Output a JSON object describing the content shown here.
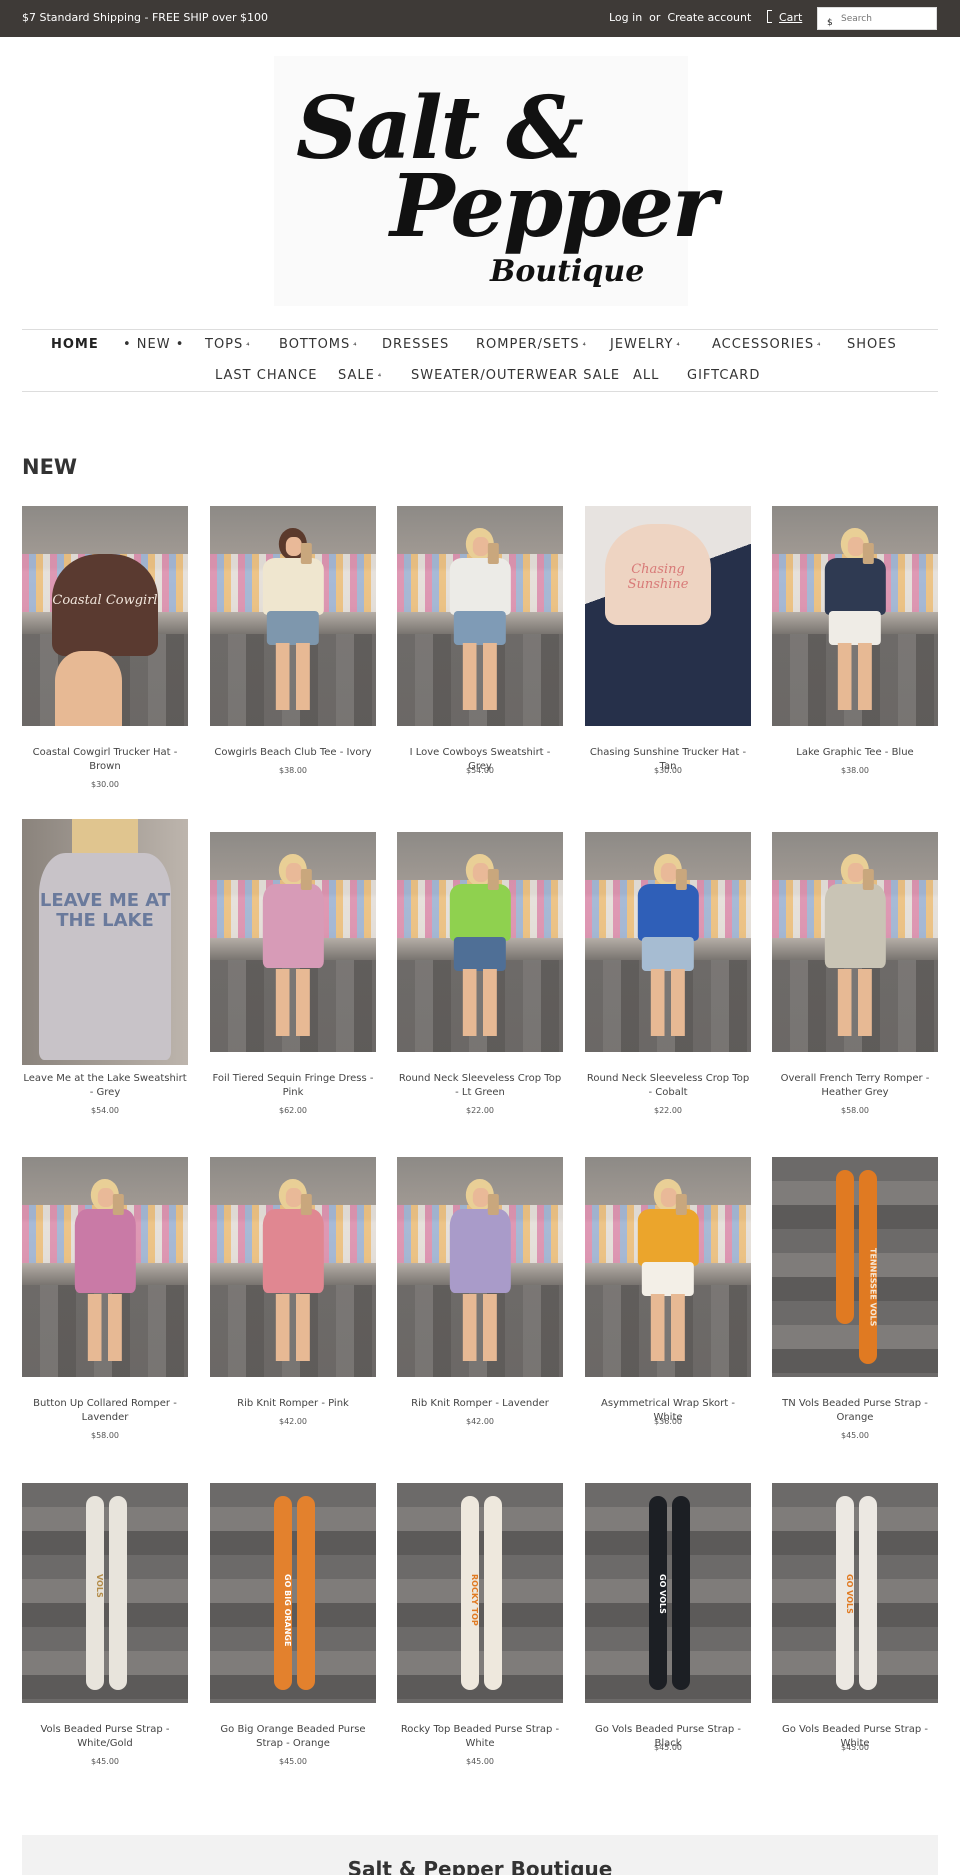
{
  "topbar": {
    "shipping": "$7 Standard Shipping - FREE SHIP over $100",
    "login": "Log in",
    "or": "or",
    "create_account": "Create account",
    "cart": "Cart",
    "search_icon_glyph": "$",
    "search_placeholder": "Search"
  },
  "logo": {
    "line1": "Salt &",
    "line2": "Pepper",
    "line3": "Boutique"
  },
  "nav": {
    "items": [
      {
        "label": "HOME"
      },
      {
        "label": "• NEW •"
      },
      {
        "label": "TOPS"
      },
      {
        "label": "BOTTOMS"
      },
      {
        "label": "DRESSES"
      },
      {
        "label": "ROMPER/SETS"
      },
      {
        "label": "JEWELRY"
      },
      {
        "label": "ACCESSORIES"
      },
      {
        "label": "SHOES"
      },
      {
        "label": "LAST CHANCE"
      },
      {
        "label": "SALE"
      },
      {
        "label": "SWEATER/OUTERWEAR SALE"
      },
      {
        "label": "ALL"
      },
      {
        "label": "GIFTCARD"
      }
    ],
    "dropdown_glyph": "⁴"
  },
  "section_title": "NEW",
  "products": [
    {
      "name": "Coastal Cowgirl Trucker Hat - Brown",
      "price": "$30.00",
      "image_text": "Coastal Cowgirl"
    },
    {
      "name": "Cowgirls Beach Club Tee - Ivory",
      "price": "$38.00"
    },
    {
      "name": "I Love Cowboys Sweatshirt - Grey",
      "price": "$54.00"
    },
    {
      "name": "Chasing Sunshine Trucker Hat - Tan",
      "price": "$30.00",
      "image_text": "Chasing Sunshine"
    },
    {
      "name": "Lake Graphic Tee - Blue",
      "price": "$38.00"
    },
    {
      "name": "Leave Me at the Lake Sweatshirt - Grey",
      "price": "$54.00",
      "image_text": "LEAVE ME AT THE LAKE"
    },
    {
      "name": "Foil Tiered Sequin Fringe Dress - Pink",
      "price": "$62.00"
    },
    {
      "name": "Round Neck Sleeveless Crop Top - Lt Green",
      "price": "$22.00"
    },
    {
      "name": "Round Neck Sleeveless Crop Top - Cobalt",
      "price": "$22.00"
    },
    {
      "name": "Overall French Terry Romper - Heather Grey",
      "price": "$58.00"
    },
    {
      "name": "Button Up Collared Romper - Lavender",
      "price": "$58.00"
    },
    {
      "name": "Rib Knit Romper - Pink",
      "price": "$42.00"
    },
    {
      "name": "Rib Knit Romper - Lavender",
      "price": "$42.00"
    },
    {
      "name": "Asymmetrical Wrap Skort - White",
      "price": "$36.00"
    },
    {
      "name": "TN Vols Beaded Purse Strap - Orange",
      "price": "$45.00",
      "image_text": "TENNESSEE VOLS"
    },
    {
      "name": "Vols Beaded Purse Strap - White/Gold",
      "price": "$45.00",
      "image_text": "VOLS"
    },
    {
      "name": "Go Big Orange Beaded Purse Strap - Orange",
      "price": "$45.00",
      "image_text": "GO BIG ORANGE"
    },
    {
      "name": "Rocky Top Beaded Purse Strap - White",
      "price": "$45.00",
      "image_text": "ROCKY TOP"
    },
    {
      "name": "Go Vols Beaded Purse Strap - Black",
      "price": "$45.00",
      "image_text": "GO VOLS"
    },
    {
      "name": "Go Vols Beaded Purse Strap - White",
      "price": "$45.00",
      "image_text": "GO VOLS"
    }
  ],
  "footer": {
    "title": "Salt & Pepper Boutique"
  },
  "colors": {
    "topbar_bg": "#3e3a37",
    "text": "#333333",
    "footer_bg": "#f2f2f2"
  }
}
